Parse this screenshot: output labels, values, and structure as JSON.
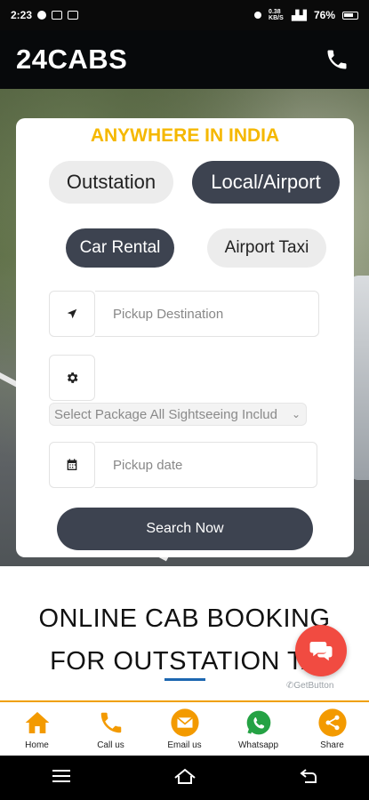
{
  "status_bar": {
    "time": "2:23",
    "speed": "0.38 KB/S",
    "battery": "76%"
  },
  "app": {
    "brand": "24CABS"
  },
  "booking": {
    "title": "ANYWHERE IN INDIA",
    "trip_types": [
      "Outstation",
      "Local/Airport"
    ],
    "services": [
      "Car Rental",
      "Airport Taxi"
    ],
    "pickup_placeholder": "Pickup Destination",
    "package_value": "Select Package All Sightseeing Includ",
    "date_placeholder": "Pickup date",
    "search_label": "Search Now"
  },
  "section": {
    "heading_line1": "ONLINE CAB BOOKING",
    "heading_line2": "FOR OUTSTATION TA"
  },
  "widget": {
    "label": "GetButton"
  },
  "bottom_nav": {
    "items": [
      {
        "label": "Home",
        "icon": "home-icon"
      },
      {
        "label": "Call us",
        "icon": "phone-icon"
      },
      {
        "label": "Email us",
        "icon": "mail-icon"
      },
      {
        "label": "Whatsapp",
        "icon": "whatsapp-icon"
      },
      {
        "label": "Share",
        "icon": "share-icon"
      }
    ]
  },
  "colors": {
    "accent": "#f5b800",
    "dark_pill": "#3d4350",
    "chat": "#f14b41",
    "nav_orange": "#f0a000"
  }
}
